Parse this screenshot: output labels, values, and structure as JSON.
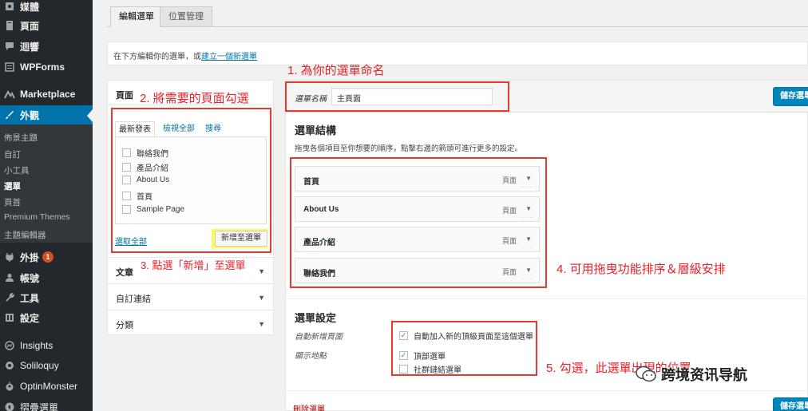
{
  "sidebar": {
    "items": [
      {
        "label": "媒體",
        "icon": "media-icon"
      },
      {
        "label": "頁面",
        "icon": "pages-icon"
      },
      {
        "label": "迴響",
        "icon": "comments-icon"
      },
      {
        "label": "WPForms",
        "icon": "wpforms-icon"
      },
      {
        "label": "Marketplace",
        "icon": "marketplace-icon"
      },
      {
        "label": "外觀",
        "icon": "appearance-icon"
      },
      {
        "label": "外掛",
        "icon": "plugins-icon",
        "badge": "1"
      },
      {
        "label": "帳號",
        "icon": "users-icon"
      },
      {
        "label": "工具",
        "icon": "tools-icon"
      },
      {
        "label": "設定",
        "icon": "settings-icon"
      },
      {
        "label": "Insights",
        "icon": "insights-icon"
      },
      {
        "label": "Soliloquy",
        "icon": "soliloquy-icon"
      },
      {
        "label": "OptinMonster",
        "icon": "optinmonster-icon"
      },
      {
        "label": "摺疊選單",
        "icon": "collapse-icon"
      }
    ],
    "submenu": [
      "佈景主題",
      "自訂",
      "小工具",
      "選單",
      "頁首",
      "Premium Themes",
      "主題編輯器"
    ]
  },
  "tabs": {
    "edit": "編輯選單",
    "locations": "位置管理"
  },
  "info": {
    "text": "在下方編輯你的選單，或",
    "link": "建立一個新選單"
  },
  "left_panel": {
    "pages_title": "頁面",
    "inner_tabs": {
      "recent": "最新發表",
      "view_all": "檢視全部",
      "search": "搜尋"
    },
    "pages": [
      "聯絡我們",
      "產品介紹",
      "About Us",
      "首頁",
      "Sample Page"
    ],
    "select_all": "選取全部",
    "add_button": "新增至選單",
    "sections": [
      "文章",
      "自訂連結",
      "分類"
    ]
  },
  "menu_editor": {
    "name_label": "選單名稱",
    "name_value": "主頁面",
    "save_label": "儲存選單",
    "structure_title": "選單結構",
    "structure_desc": "拖曳各個項目至你想要的順序，點擊右邊的箭頭可進行更多的設定。",
    "items": [
      {
        "title": "首頁",
        "type": "頁面"
      },
      {
        "title": "About Us",
        "type": "頁面"
      },
      {
        "title": "產品介紹",
        "type": "頁面"
      },
      {
        "title": "聯絡我們",
        "type": "頁面"
      }
    ],
    "settings_title": "選單設定",
    "auto_add_label": "自動新增頁面",
    "auto_add_option": "自動加入新的頂級頁面至這個選單",
    "auto_add_checked": true,
    "display_label": "顯示地點",
    "locations": [
      {
        "label": "頂部選單",
        "checked": true
      },
      {
        "label": "社群鏈結選單",
        "checked": false
      }
    ],
    "delete_label": "刪除選單"
  },
  "annotations": {
    "a1": "1. 為你的選單命名",
    "a2": "2. 將需要的頁面勾選",
    "a3": "3. 點選「新增」至選單",
    "a4": "4. 可用拖曳功能排序＆層級安排",
    "a5": "5. 勾選，此選單出現的位置"
  },
  "watermark": "跨境资讯导航",
  "colors": {
    "sidebar_bg": "#23282d",
    "active": "#0073aa",
    "primary_button": "#0085ba",
    "annotation_red": "#e5212a",
    "badge": "#d54e21"
  }
}
